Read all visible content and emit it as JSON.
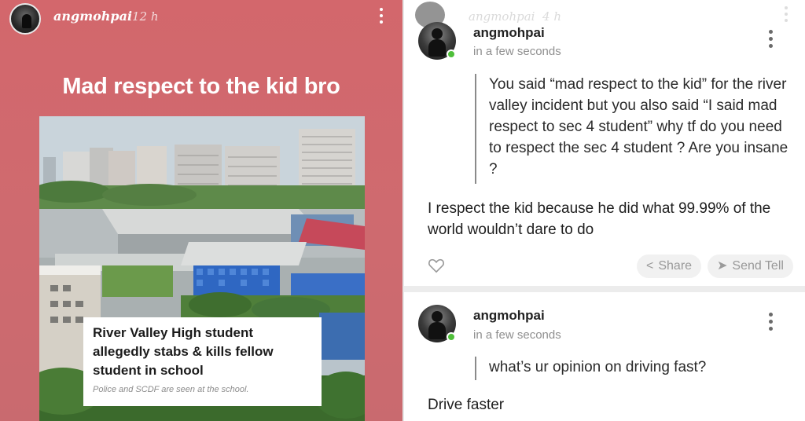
{
  "story": {
    "username": "angmohpai",
    "time": "12 h",
    "headline": "Mad respect to the kid bro",
    "article": {
      "title": "River Valley High student allegedly stabs & kills fellow student in school",
      "caption": "Police and SCDF are seen at the school."
    }
  },
  "ghost": {
    "username": "angmohpai",
    "time": "4 h"
  },
  "posts": [
    {
      "username": "angmohpai",
      "timestamp": "in a few seconds",
      "question": "You said “mad respect to the kid” for the river valley incident but you also said “I said mad respect to sec 4 student” why tf do you need to respect the sec 4 student ? Are you insane ?",
      "answer": "I respect the kid because he did what 99.99% of the world wouldn’t dare to do",
      "share_label": "Share",
      "send_label": "Send Tell"
    },
    {
      "username": "angmohpai",
      "timestamp": "in a few seconds",
      "question": "what’s ur opinion on driving fast?",
      "answer": "Drive faster"
    }
  ],
  "icons": {
    "more": "more-vertical-icon",
    "heart": "heart-icon",
    "share": "share-icon",
    "send": "send-icon"
  },
  "colors": {
    "story_bg": "#d3676c",
    "online": "#4fbf3a",
    "chip_bg": "#f1f1f1"
  }
}
